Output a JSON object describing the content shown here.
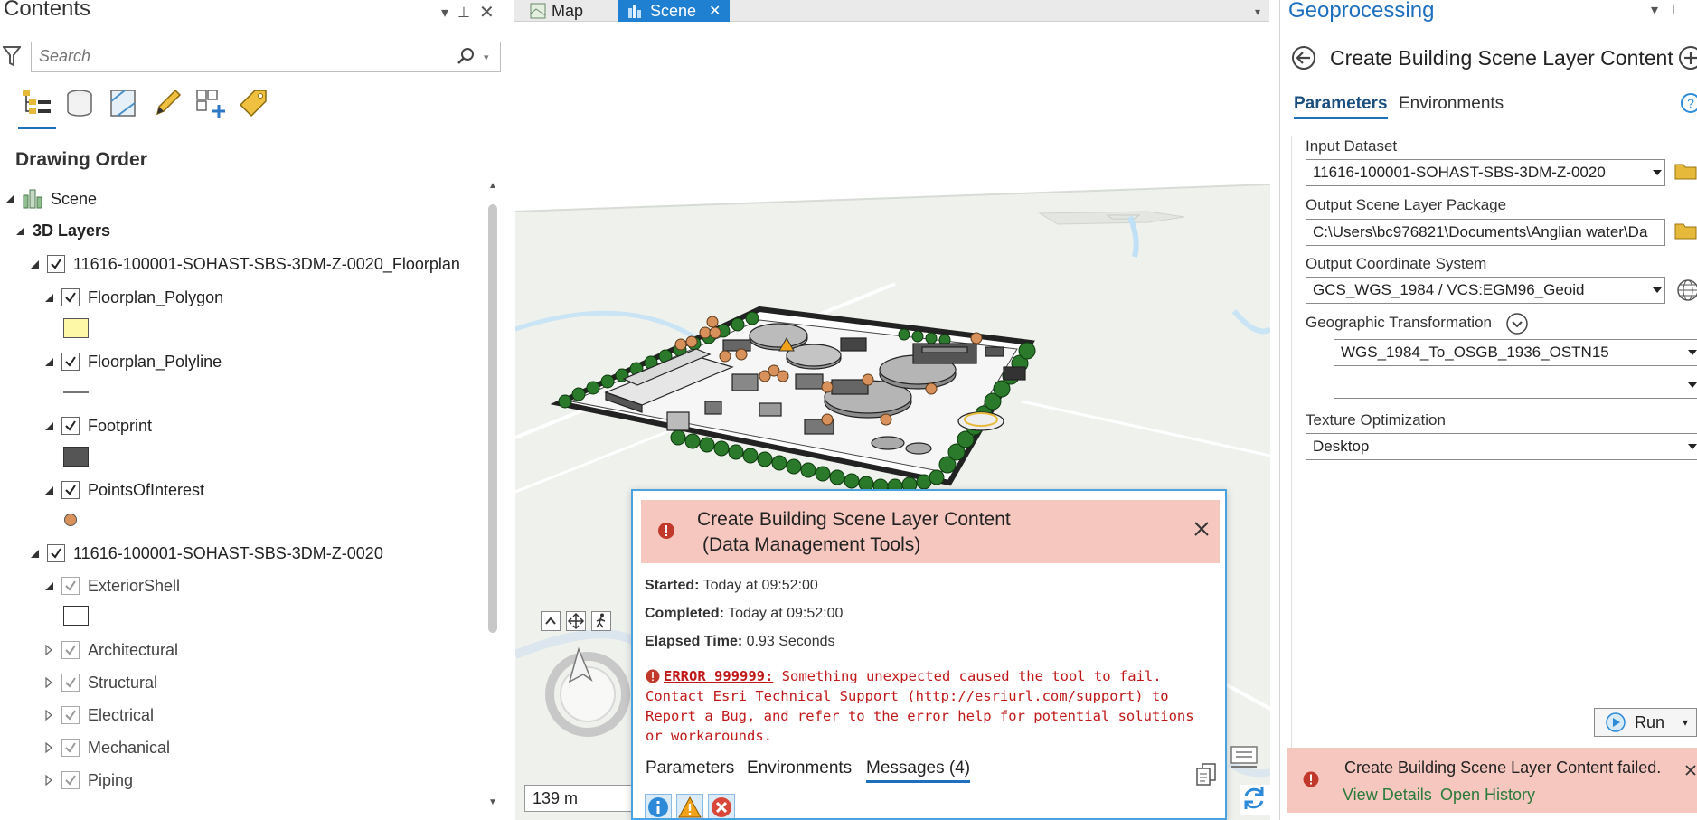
{
  "contents": {
    "title": "Contents",
    "search_placeholder": "Search",
    "drawing_order": "Drawing Order",
    "scene_label": "Scene",
    "layers_group": "3D Layers",
    "layers": [
      {
        "label": "11616-100001-SOHAST-SBS-3DM-Z-0020_Floorplan"
      },
      {
        "label": "Floorplan_Polygon"
      },
      {
        "label": "Floorplan_Polyline"
      },
      {
        "label": "Footprint"
      },
      {
        "label": "PointsOfInterest"
      },
      {
        "label": "11616-100001-SOHAST-SBS-3DM-Z-0020"
      },
      {
        "label": "ExteriorShell"
      },
      {
        "label": "Architectural"
      },
      {
        "label": "Structural"
      },
      {
        "label": "Electrical"
      },
      {
        "label": "Mechanical"
      },
      {
        "label": "Piping"
      }
    ]
  },
  "map": {
    "tab_map": "Map",
    "tab_scene": "Scene",
    "scale": "139 m"
  },
  "popup": {
    "title_line1": "Create Building Scene Layer Content",
    "title_line2": "(Data Management Tools)",
    "started_label": "Started:",
    "started_value": "Today at 09:52:00",
    "completed_label": "Completed:",
    "completed_value": "Today at 09:52:00",
    "elapsed_label": "Elapsed Time:",
    "elapsed_value": "0.93 Seconds",
    "error_code": "ERROR 999999:",
    "error_message": " Something unexpected caused the tool to fail. Contact Esri Technical Support (http://esriurl.com/support) to Report a Bug, and refer to the error help for potential solutions or workarounds.",
    "tab_parameters": "Parameters",
    "tab_environments": "Environments",
    "tab_messages": "Messages (4)"
  },
  "geoprocessing": {
    "title": "Geoprocessing",
    "tool_name": "Create Building Scene Layer Content",
    "tab_parameters": "Parameters",
    "tab_environments": "Environments",
    "input_dataset_label": "Input Dataset",
    "input_dataset_value": "11616-100001-SOHAST-SBS-3DM-Z-0020",
    "output_package_label": "Output Scene Layer Package",
    "output_package_value": "C:\\Users\\bc976821\\Documents\\Anglian water\\Da",
    "output_cs_label": "Output Coordinate System",
    "output_cs_value": "GCS_WGS_1984 / VCS:EGM96_Geoid",
    "geo_transform_label": "Geographic Transformation",
    "geo_transform_value": "WGS_1984_To_OSGB_1936_OSTN15",
    "geo_transform_value2": "",
    "texture_label": "Texture Optimization",
    "texture_value": "Desktop",
    "run_label": "Run",
    "fail_message": "Create Building Scene Layer Content failed.",
    "view_details": "View Details",
    "open_history": "Open History"
  },
  "colors": {
    "accent": "#1f6fbf",
    "error_bg": "#f5c7bf",
    "error_text": "#c01818",
    "polygon_swatch": "#fdf7a8",
    "footprint_swatch": "#555555",
    "poi_swatch": "#d9915c"
  }
}
